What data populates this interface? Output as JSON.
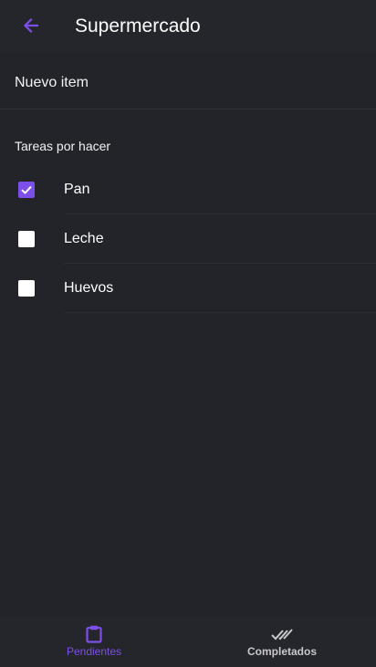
{
  "app_bar": {
    "title": "Supermercado",
    "back_icon": "arrow-left-icon"
  },
  "new_item": {
    "label": "Nuevo item"
  },
  "section": {
    "title": "Tareas por hacer"
  },
  "tasks": [
    {
      "label": "Pan",
      "checked": true
    },
    {
      "label": "Leche",
      "checked": false
    },
    {
      "label": "Huevos",
      "checked": false
    }
  ],
  "bottom_nav": {
    "items": [
      {
        "label": "Pendientes",
        "icon": "clipboard-icon",
        "active": true
      },
      {
        "label": "Completados",
        "icon": "double-check-icon",
        "active": false
      }
    ]
  },
  "colors": {
    "background": "#232429",
    "accent": "#7b4fe8",
    "text": "#ffffff"
  }
}
